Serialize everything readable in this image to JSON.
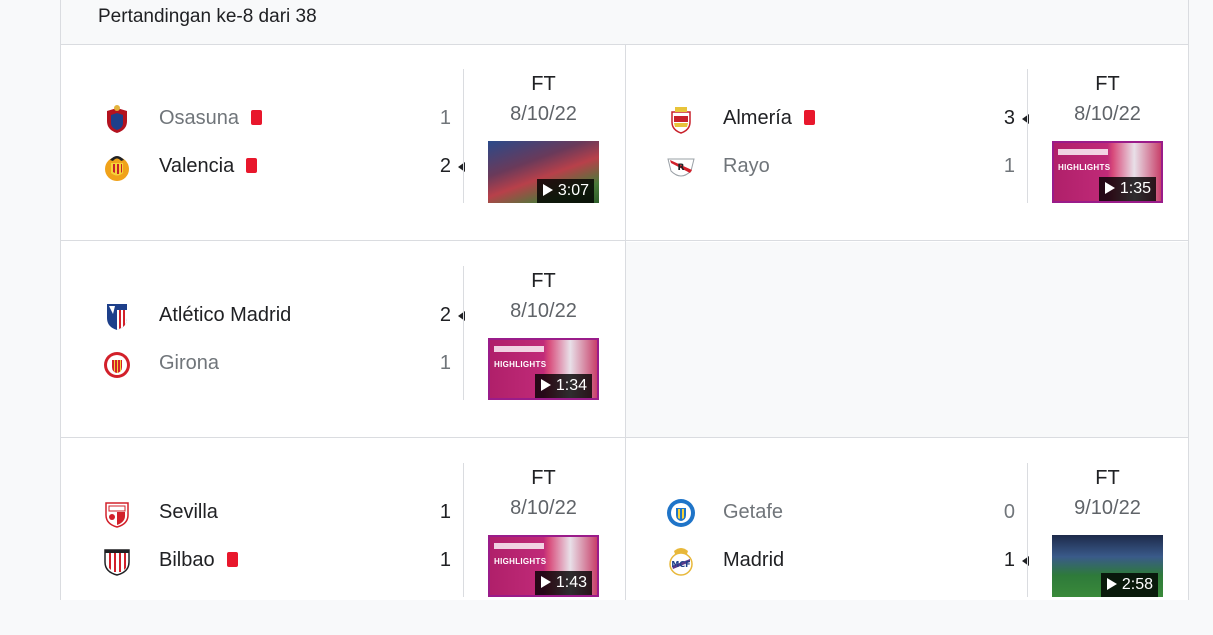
{
  "round_label": "Pertandingan ke-8 dari 38",
  "video_label": "HIGHLIGHTS",
  "matches": [
    {
      "status": "FT",
      "date": "8/10/22",
      "video_duration": "3:07",
      "home": {
        "name": "Osasuna",
        "score": "1",
        "red_card": true,
        "winner": false
      },
      "away": {
        "name": "Valencia",
        "score": "2",
        "red_card": true,
        "winner": true
      }
    },
    {
      "status": "FT",
      "date": "8/10/22",
      "video_duration": "1:35",
      "home": {
        "name": "Almería",
        "score": "3",
        "red_card": true,
        "winner": true
      },
      "away": {
        "name": "Rayo",
        "score": "1",
        "red_card": false,
        "winner": false
      }
    },
    {
      "status": "FT",
      "date": "8/10/22",
      "video_duration": "1:34",
      "home": {
        "name": "Atlético Madrid",
        "score": "2",
        "red_card": false,
        "winner": true
      },
      "away": {
        "name": "Girona",
        "score": "1",
        "red_card": false,
        "winner": false
      }
    },
    {
      "status": "FT",
      "date": "8/10/22",
      "video_duration": "1:43",
      "home": {
        "name": "Sevilla",
        "score": "1",
        "red_card": false,
        "winner": false
      },
      "away": {
        "name": "Bilbao",
        "score": "1",
        "red_card": true,
        "winner": false
      }
    },
    {
      "status": "FT",
      "date": "9/10/22",
      "video_duration": "2:58",
      "home": {
        "name": "Getafe",
        "score": "0",
        "red_card": false,
        "winner": false
      },
      "away": {
        "name": "Madrid",
        "score": "1",
        "red_card": false,
        "winner": true
      }
    }
  ],
  "colors": {
    "red_card": "#e8172c",
    "divider": "#dadce0",
    "muted_text": "#70757a",
    "highlight_magenta": "#b0206a"
  },
  "icons": {
    "osasuna": "osasuna-crest-icon",
    "valencia": "valencia-crest-icon",
    "almeria": "almeria-crest-icon",
    "rayo": "rayo-crest-icon",
    "atletico": "atletico-crest-icon",
    "girona": "girona-crest-icon",
    "sevilla": "sevilla-crest-icon",
    "bilbao": "bilbao-crest-icon",
    "getafe": "getafe-crest-icon",
    "madrid": "madrid-crest-icon"
  }
}
